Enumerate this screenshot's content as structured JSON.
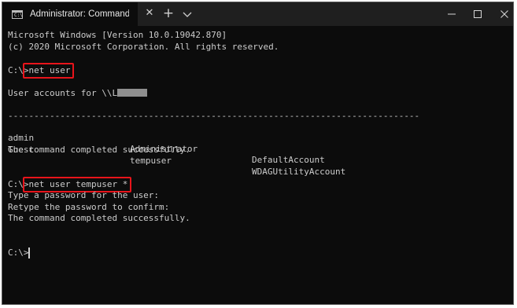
{
  "window": {
    "tab_title": "Administrator: Command Prompt",
    "tab_icon_text": "C:\\",
    "icons": [
      "cmd-icon",
      "close-icon",
      "plus-icon",
      "chevron-down-icon",
      "minimize-icon",
      "maximize-icon",
      "window-close-icon"
    ]
  },
  "console": {
    "banner_line1": "Microsoft Windows [Version 10.0.19042.870]",
    "banner_line2": "(c) 2020 Microsoft Corporation. All rights reserved.",
    "prompt1": "C:\\>",
    "cmd1": "net user",
    "accounts_header": "User accounts for \\\\L",
    "separator": "-------------------------------------------------------------------------------",
    "accounts": [
      [
        "admin",
        "Administrator",
        "DefaultAccount"
      ],
      [
        "Guest",
        "tempuser",
        "WDAGUtilityAccount"
      ]
    ],
    "completed1": "The command completed successfully.",
    "prompt2": "C:\\>",
    "cmd2": "net user tempuser *",
    "type_pw": "Type a password for the user:",
    "retype_pw": "Retype the password to confirm:",
    "completed2": "The command completed successfully.",
    "prompt3": "C:\\>"
  },
  "colors": {
    "background": "#0c0c0c",
    "text": "#cccccc",
    "highlight": "#e8141b"
  }
}
